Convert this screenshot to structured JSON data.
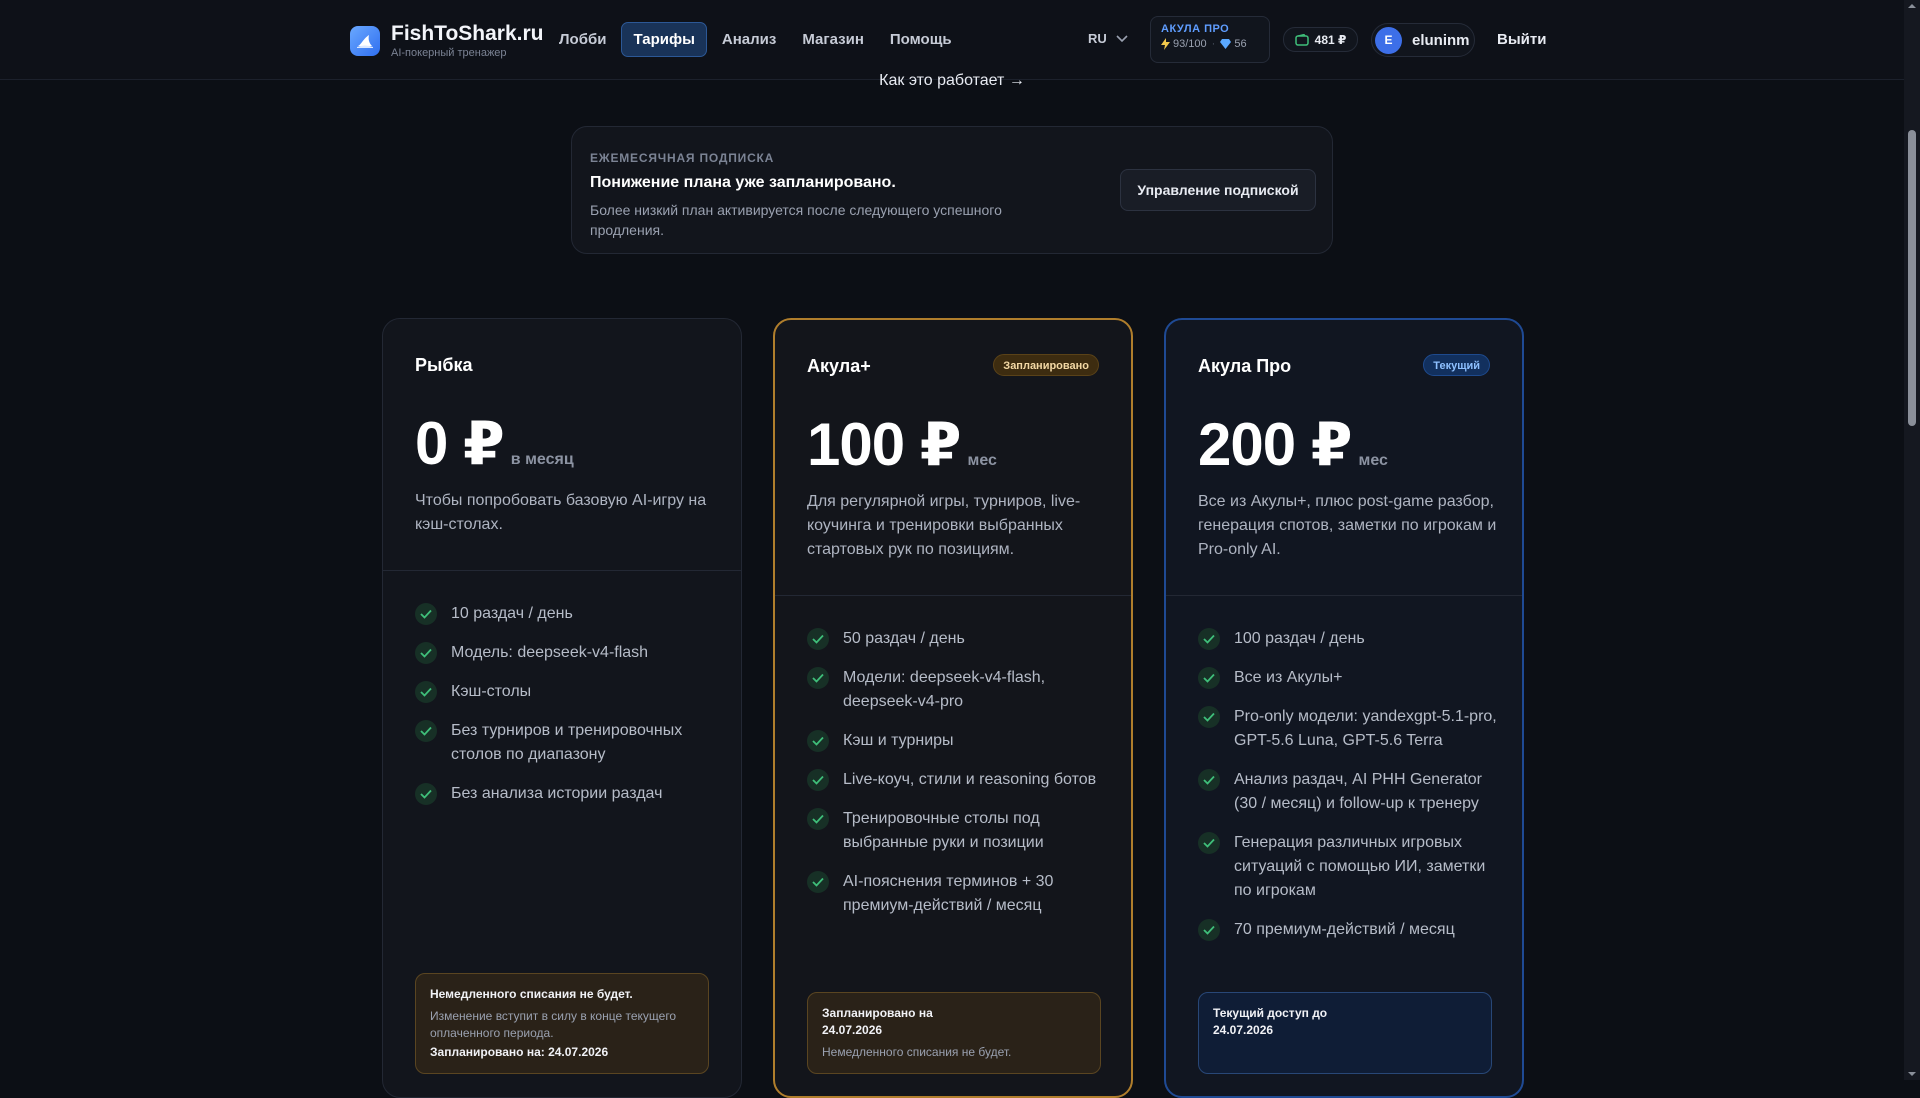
{
  "header": {
    "brand_name": "FishToShark.ru",
    "brand_sub": "AI-покерный тренажер",
    "nav": [
      {
        "label": "Лобби",
        "active": false
      },
      {
        "label": "Тарифы",
        "active": true
      },
      {
        "label": "Анализ",
        "active": false
      },
      {
        "label": "Магазин",
        "active": false
      },
      {
        "label": "Помощь",
        "active": false
      }
    ],
    "language": "RU",
    "plan": {
      "name": "АКУЛА ПРО",
      "hands": "93/100",
      "gems": "56"
    },
    "wallet": "481 ₽",
    "user": {
      "avatar_letter": "E",
      "name": "eluninm"
    },
    "logout": "Выйти"
  },
  "how_it_works": "Как это работает →",
  "subscription": {
    "label": "ЕЖЕМЕСЯЧНАЯ ПОДПИСКА",
    "title": "Понижение плана уже запланировано.",
    "description": "Более низкий план активируется после следующего успешного продления.",
    "button": "Управление подпиской"
  },
  "plans": [
    {
      "name": "Рыбка",
      "badge": "",
      "price": "0 ₽",
      "period": "в месяц",
      "description": "Чтобы попробовать базовую AI-игру на кэш-столах.",
      "features": [
        "10 раздач / день",
        "Модель: deepseek-v4-flash",
        "Кэш-столы",
        "Без турниров и тренировочных столов по диапазону",
        "Без анализа истории раздач"
      ],
      "note": {
        "title": "Немедленного списания не будет.",
        "text": "Изменение вступит в силу в конце текущего оплаченного периода.",
        "strong": "Запланировано на: 24.07.2026"
      }
    },
    {
      "name": "Акула+",
      "badge": "Запланировано",
      "price": "100 ₽",
      "period": "мес",
      "description": "Для регулярной игры, турниров, live-коучинга и тренировки выбранных стартовых рук по позициям.",
      "features": [
        "50 раздач / день",
        "Модели: deepseek-v4-flash, deepseek-v4-pro",
        "Кэш и турниры",
        "Live-коуч, стили и reasoning ботов",
        "Тренировочные столы под выбранные руки и позиции",
        "AI-пояснения терминов + 30 премиум-действий / месяц"
      ],
      "note": {
        "title": "Запланировано на 24.07.2026",
        "text": "Немедленного списания не будет."
      }
    },
    {
      "name": "Акула Про",
      "badge": "Текущий",
      "price": "200 ₽",
      "period": "мес",
      "description": "Все из Акулы+, плюс post-game разбор, генерация спотов, заметки по игрокам и Pro-only AI.",
      "features": [
        "100 раздач / день",
        "Все из Акулы+",
        "Pro-only модели: yandexgpt-5.1-pro, GPT-5.6 Luna, GPT-5.6 Terra",
        "Анализ раздач, AI PHH Generator (30 / месяц) и follow-up к тренеру",
        "Генерация различных игровых ситуаций с помощью ИИ, заметки по игрокам",
        "70 премиум-действий / месяц"
      ],
      "note": {
        "title": "Текущий доступ до 24.07.2026"
      }
    }
  ],
  "colors": {
    "background": "#0c0f15",
    "accent_blue": "#2f6ff0",
    "scheduled_border": "#b07e2c",
    "current_border": "#1f4a94",
    "check_green": "#3fbf7a"
  }
}
